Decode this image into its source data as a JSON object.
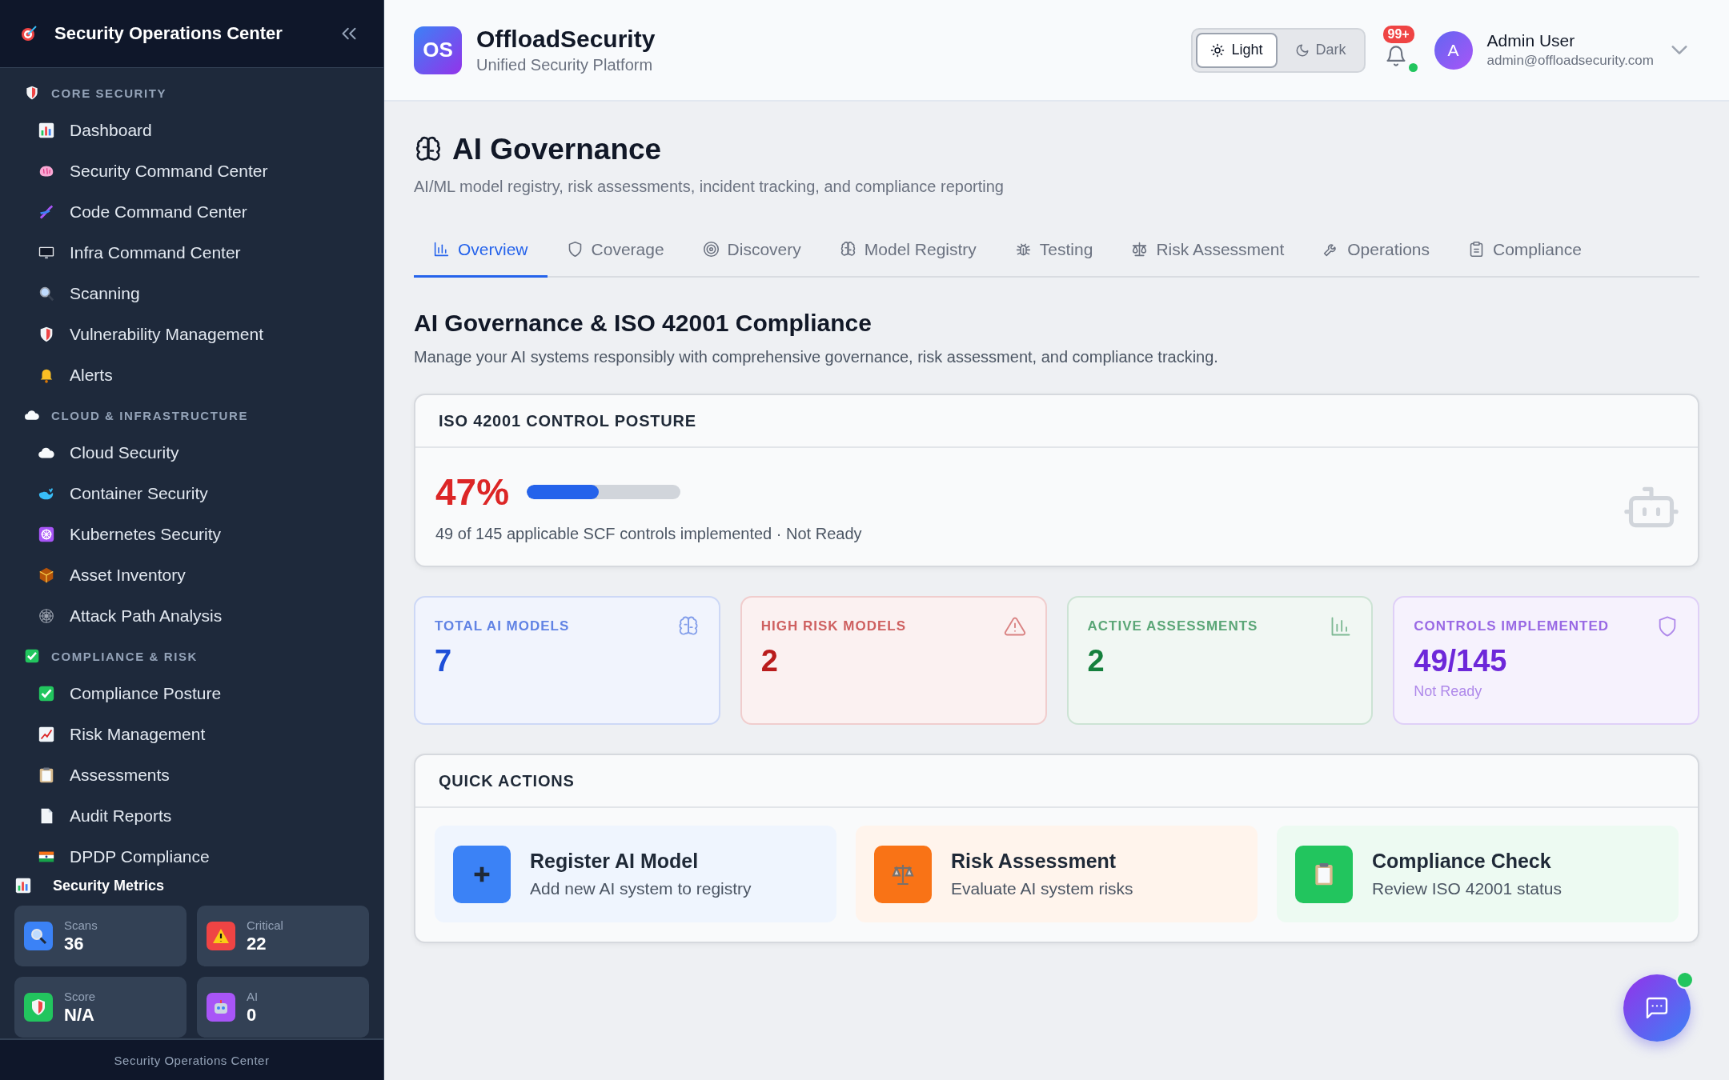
{
  "sidebar": {
    "title": "Security Operations Center",
    "sections": [
      {
        "label": "CORE SECURITY",
        "items": [
          {
            "label": "Dashboard"
          },
          {
            "label": "Security Command Center"
          },
          {
            "label": "Code Command Center"
          },
          {
            "label": "Infra Command Center"
          },
          {
            "label": "Scanning"
          },
          {
            "label": "Vulnerability Management"
          },
          {
            "label": "Alerts"
          }
        ]
      },
      {
        "label": "CLOUD & INFRASTRUCTURE",
        "items": [
          {
            "label": "Cloud Security"
          },
          {
            "label": "Container Security"
          },
          {
            "label": "Kubernetes Security"
          },
          {
            "label": "Asset Inventory"
          },
          {
            "label": "Attack Path Analysis"
          }
        ]
      },
      {
        "label": "COMPLIANCE & RISK",
        "items": [
          {
            "label": "Compliance Posture"
          },
          {
            "label": "Risk Management"
          },
          {
            "label": "Assessments"
          },
          {
            "label": "Audit Reports"
          },
          {
            "label": "DPDP Compliance"
          }
        ]
      }
    ],
    "metrics_title": "Security Metrics",
    "metrics": [
      {
        "label": "Scans",
        "value": "36",
        "color": "#3b82f6"
      },
      {
        "label": "Critical",
        "value": "22",
        "color": "#ef4444"
      },
      {
        "label": "Score",
        "value": "N/A",
        "color": "#22c55e"
      },
      {
        "label": "AI",
        "value": "0",
        "color": "#a855f7"
      }
    ],
    "footer": "Security Operations Center"
  },
  "header": {
    "logo": "OS",
    "brand": "OffloadSecurity",
    "tagline": "Unified Security Platform",
    "theme": [
      {
        "label": "Light",
        "selected": true
      },
      {
        "label": "Dark",
        "selected": false
      }
    ],
    "notifications": "99+",
    "user": {
      "avatar": "A",
      "name": "Admin User",
      "email": "admin@offloadsecurity.com"
    }
  },
  "page": {
    "title": "AI Governance",
    "subtitle": "AI/ML model registry, risk assessments, incident tracking, and compliance reporting",
    "tabs": [
      {
        "label": "Overview",
        "selected": true
      },
      {
        "label": "Coverage",
        "selected": false
      },
      {
        "label": "Discovery",
        "selected": false
      },
      {
        "label": "Model Registry",
        "selected": false
      },
      {
        "label": "Testing",
        "selected": false
      },
      {
        "label": "Risk Assessment",
        "selected": false
      },
      {
        "label": "Operations",
        "selected": false
      },
      {
        "label": "Compliance",
        "selected": false
      }
    ],
    "section_title": "AI Governance & ISO 42001 Compliance",
    "section_description": "Manage your AI systems responsibly with comprehensive governance, risk assessment, and compliance tracking.",
    "posture": {
      "title": "ISO 42001 CONTROL POSTURE",
      "percent": "47%",
      "level": 0.47,
      "summary": "49 of 145 applicable SCF controls implemented · Not Ready"
    },
    "stats": [
      {
        "label": "TOTAL AI MODELS",
        "value": "7",
        "color": "#1d4ed8"
      },
      {
        "label": "HIGH RISK MODELS",
        "value": "2",
        "color": "#b91c1c"
      },
      {
        "label": "ACTIVE ASSESSMENTS",
        "value": "2",
        "color": "#15803d"
      },
      {
        "label": "CONTROLS IMPLEMENTED",
        "value": "49/145",
        "note": "Not Ready",
        "color": "#6d28d9"
      }
    ],
    "quick_actions": {
      "title": "QUICK ACTIONS",
      "items": [
        {
          "title": "Register AI Model",
          "description": "Add new AI system to registry",
          "color": "#3b82f6"
        },
        {
          "title": "Risk Assessment",
          "description": "Evaluate AI system risks",
          "color": "#f97316"
        },
        {
          "title": "Compliance Check",
          "description": "Review ISO 42001 status",
          "color": "#22c55e"
        }
      ]
    }
  }
}
